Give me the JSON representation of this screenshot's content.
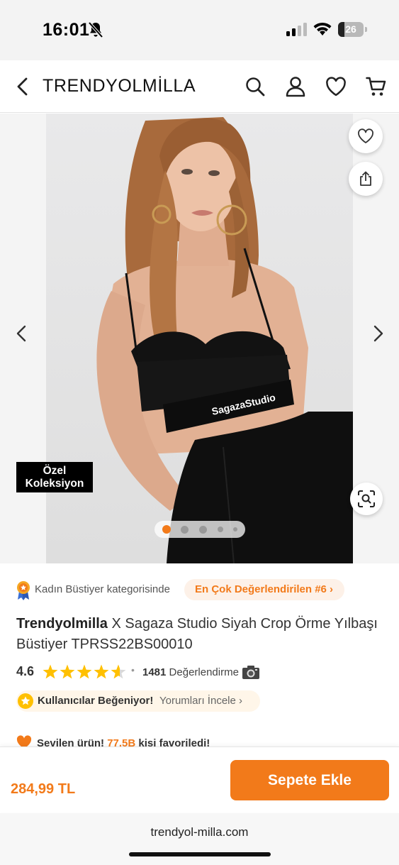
{
  "status_bar": {
    "time": "16:01",
    "battery": "26",
    "battery_level": 0.26
  },
  "header": {
    "title": "TRENDYOLMİLLA"
  },
  "gallery": {
    "badge_line1": "Özel",
    "badge_line2": "Koleksiyon",
    "band_text": "SagazaStudio",
    "pages": 5,
    "active_page": 1
  },
  "category": {
    "prefix": "Kadın Büstiyer kategorisinde",
    "pill": "En Çok Değerlendirilen #6 ›"
  },
  "product": {
    "brand": "Trendyolmilla",
    "name": "X Sagaza Studio Siyah Crop Örme Yılbaşı Büstiyer TPRSS22BS00010"
  },
  "rating": {
    "value": "4.6",
    "stars": 4.6,
    "count": "1481",
    "count_label": "Değerlendirme"
  },
  "likes": {
    "label": "Kullanıcılar Beğeniyor!",
    "link": "Yorumları İncele ›"
  },
  "favorite": {
    "prefix": "Sevilen ürün!",
    "count": "77,5B",
    "suffix": "kişi favoriledi!"
  },
  "purchase": {
    "price": "284,99 TL",
    "button": "Sepete Ekle"
  },
  "browser": {
    "url": "trendyol-milla.com"
  },
  "colors": {
    "accent": "#f27a1a",
    "star": "#ffc000"
  }
}
